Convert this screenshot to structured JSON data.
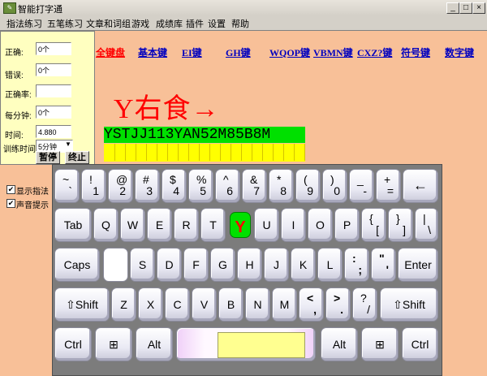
{
  "window": {
    "title": "智能打字通",
    "minimize": "_",
    "maximize": "□",
    "close": "×"
  },
  "menu": [
    "指法练习",
    "五笔练习",
    "文章和词组",
    "游戏",
    "成绩库",
    "插件",
    "设置",
    "帮助"
  ],
  "stats": {
    "correct_label": "正确:",
    "correct_value": "0个",
    "wrong_label": "错误:",
    "wrong_value": "0个",
    "rate_label": "正确率:",
    "rate_value": "",
    "per_minute_label": "每分钟:",
    "per_minute_value": "0个",
    "time_label": "时间:",
    "time_value": "4.880",
    "train_time_label": "训练时间",
    "train_time_value": "5分钟",
    "pause_button": "暂停",
    "stop_button": "终止"
  },
  "options": [
    {
      "label": "显示指法",
      "checked": true
    },
    {
      "label": "声音提示",
      "checked": true
    }
  ],
  "nav_links": [
    "全键盘",
    "基本键",
    "EI键",
    "GH键",
    "WQOP键",
    "VBMN键",
    "CXZ?键",
    "符号键",
    "数字键"
  ],
  "hint": "Y右食→",
  "practice_text": "YSTJJ113YAN52M85B8M",
  "highlighted_key": "Y",
  "keyboard": {
    "row1": [
      {
        "top": "~",
        "bottom": "`"
      },
      {
        "top": "!",
        "bottom": "1"
      },
      {
        "top": "@",
        "bottom": "2"
      },
      {
        "top": "#",
        "bottom": "3"
      },
      {
        "top": "$",
        "bottom": "4"
      },
      {
        "top": "%",
        "bottom": "5"
      },
      {
        "top": "^",
        "bottom": "6"
      },
      {
        "top": "&",
        "bottom": "7"
      },
      {
        "top": "*",
        "bottom": "8"
      },
      {
        "top": "(",
        "bottom": "9"
      },
      {
        "top": ")",
        "bottom": "0"
      },
      {
        "top": "_",
        "bottom": "-"
      },
      {
        "top": "+",
        "bottom": "="
      }
    ],
    "backspace": "←",
    "tab": "Tab",
    "row2": [
      "Q",
      "W",
      "E",
      "R",
      "T",
      "Y",
      "U",
      "I",
      "O",
      "P"
    ],
    "row2_sym": [
      {
        "top": "{",
        "bottom": "["
      },
      {
        "top": "}",
        "bottom": "]"
      },
      {
        "top": "|",
        "bottom": "\\"
      }
    ],
    "caps": "Caps",
    "row3": [
      "",
      "S",
      "D",
      "F",
      "G",
      "H",
      "J",
      "K",
      "L"
    ],
    "row3_sym": [
      {
        "top": ":",
        "bottom": ";"
      },
      {
        "top": "\"",
        "bottom": "'"
      }
    ],
    "enter": "Enter",
    "shift_left": "⇧Shift",
    "row4": [
      "Z",
      "X",
      "C",
      "V",
      "B",
      "N",
      "M"
    ],
    "row4_sym": [
      {
        "top": "<",
        "bottom": ","
      },
      {
        "top": ">",
        "bottom": "."
      },
      {
        "top": "?",
        "bottom": "/"
      }
    ],
    "shift_right": "⇧Shift",
    "ctrl_left": "Ctrl",
    "win_left": "⊞",
    "alt_left": "Alt",
    "alt_right": "Alt",
    "win_right": "⊞",
    "ctrl_right": "Ctrl"
  },
  "colors": {
    "background": "#f8c098",
    "highlight": "#00e000",
    "hint": "#ff0000",
    "link": "#0000c0"
  }
}
